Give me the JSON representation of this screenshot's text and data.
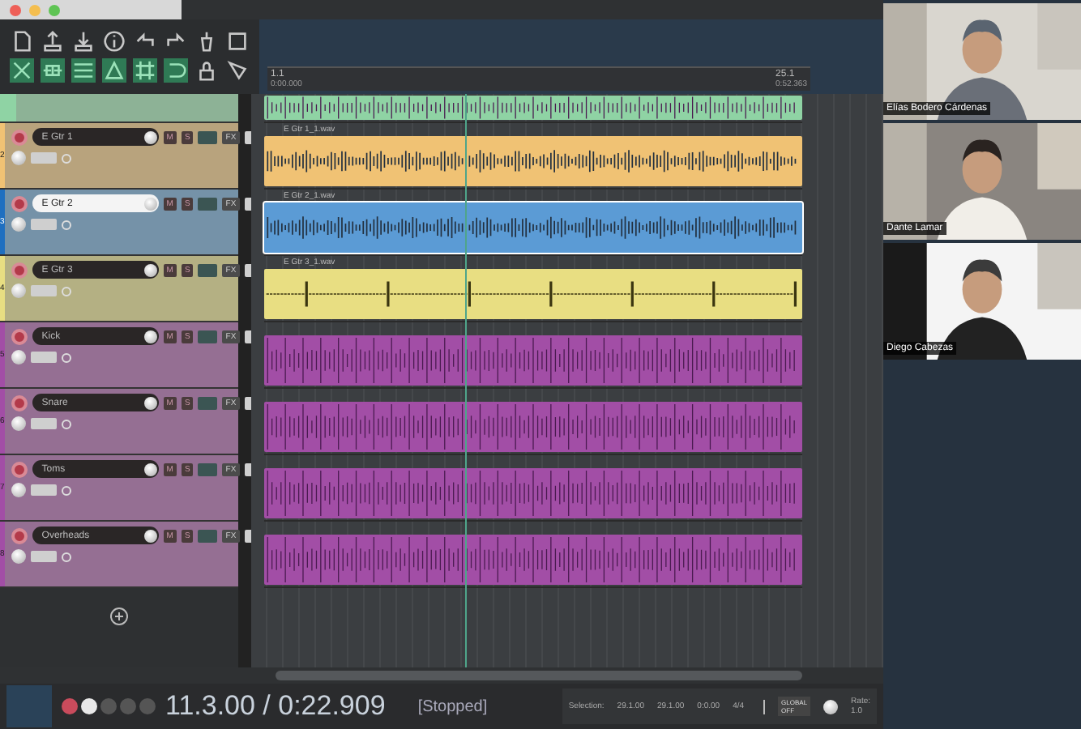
{
  "ruler": [
    {
      "bar": "1.1",
      "time": "0:00.000"
    },
    {
      "bar": "25.1",
      "time": "0:52.363"
    }
  ],
  "tracks": [
    {
      "color": "#8fd3a4",
      "selected": false,
      "kind": "partial"
    },
    {
      "number": "2",
      "name": "E Gtr 1",
      "color": "#f0c274",
      "selected": false,
      "kind": "guitar",
      "item_label": "E Gtr 1_1.wav",
      "buttons": [
        "M",
        "S",
        "FX"
      ]
    },
    {
      "number": "3",
      "name": "E Gtr 2",
      "color": "#5b9bd5",
      "selected": true,
      "kind": "guitar",
      "item_label": "E Gtr 2_1.wav",
      "buttons": [
        "M",
        "S",
        "FX"
      ]
    },
    {
      "number": "4",
      "name": "E Gtr 3",
      "color": "#e8de82",
      "selected": false,
      "kind": "sparse",
      "item_label": "E Gtr 3_1.wav",
      "buttons": [
        "M",
        "S",
        "FX"
      ]
    },
    {
      "number": "5",
      "name": "Kick",
      "color": "#a24ea6",
      "selected": false,
      "kind": "drums",
      "buttons": [
        "M",
        "S",
        "FX"
      ]
    },
    {
      "number": "6",
      "name": "Snare",
      "color": "#a24ea6",
      "selected": false,
      "kind": "drums",
      "buttons": [
        "M",
        "S",
        "FX"
      ]
    },
    {
      "number": "7",
      "name": "Toms",
      "color": "#a24ea6",
      "selected": false,
      "kind": "drums",
      "buttons": [
        "M",
        "S",
        "FX"
      ]
    },
    {
      "number": "8",
      "name": "Overheads",
      "color": "#a24ea6",
      "selected": false,
      "kind": "drums",
      "buttons": [
        "M",
        "S",
        "FX"
      ]
    }
  ],
  "transport": {
    "position": "11.3.00 / 0:22.909",
    "status": "[Stopped]",
    "selection_label": "Selection:",
    "selection": [
      "29.1.00",
      "29.1.00",
      "0:0.00"
    ],
    "time_signature": "4/4",
    "global": "GLOBAL",
    "global_state": "OFF",
    "rate_label": "Rate:",
    "rate": "1.0"
  },
  "participants": [
    {
      "name": "Elías Bodero Cárdenas"
    },
    {
      "name": "Dante Lamar"
    },
    {
      "name": "Diego Cabezas"
    }
  ]
}
